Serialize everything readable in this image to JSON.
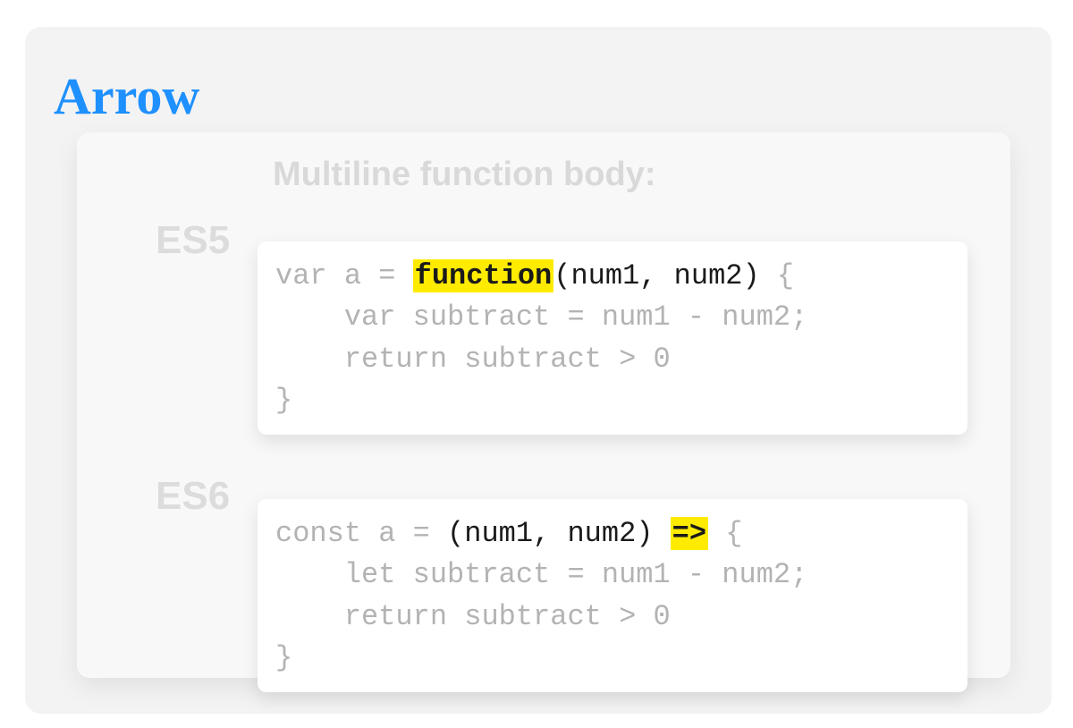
{
  "title": "Arrow",
  "subtitle": "Multiline function body:",
  "blocks": {
    "es5": {
      "label": "ES5",
      "code": {
        "l1_decl": "var a = ",
        "l1_fn": "function",
        "l1_params": "(num1, num2)",
        "l1_brace": " {",
        "l2": "    var subtract = num1 - num2;",
        "l3": "    return subtract > 0",
        "l4": "}"
      }
    },
    "es6": {
      "label": "ES6",
      "code": {
        "l1_decl": "const a = ",
        "l1_params": "(num1, num2) ",
        "l1_arrow": "=>",
        "l1_brace": " {",
        "l2": "    let subtract = num1 - num2;",
        "l3": "    return subtract > 0",
        "l4": "}"
      }
    }
  }
}
